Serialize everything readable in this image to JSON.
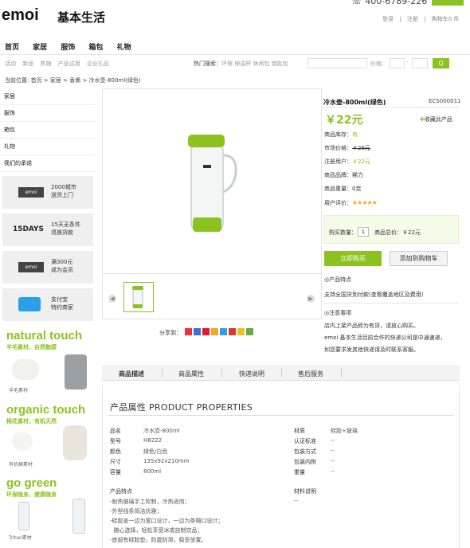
{
  "header": {
    "logo": "emoi",
    "logo_cn": "基本生活",
    "phone": "400-6789-226",
    "links": [
      "登录",
      "|",
      "注册",
      "|",
      "购物车0 件"
    ]
  },
  "nav": [
    "首页",
    "家居",
    "服饰",
    "箱包",
    "礼物"
  ],
  "subnav": [
    "活动",
    "新品",
    "热销",
    "产品试用",
    "企业礼品"
  ],
  "search": {
    "hot_label": "热门搜索：",
    "hot_terms": "环保 保温杯 休闲包 钥匙包",
    "price_label": "价格：",
    "dash": "-",
    "button": "Q"
  },
  "breadcrumb": "当前位置: 首页 > 家居 > 香熏 > 冷水壶-800ml(绿色)",
  "sidebar": {
    "items": [
      "家居",
      "服饰",
      "箱包",
      "礼物",
      "我们的承诺"
    ]
  },
  "promises": [
    {
      "title": "2000城市\n送货上门",
      "icon": "emoi"
    },
    {
      "title": "15天无条件\n退换货款",
      "icon": "15DAYS"
    },
    {
      "title": "满300元\n成为会员",
      "icon": "emoi"
    },
    {
      "title": "支付宝\n特约商家",
      "icon": "puzzle"
    }
  ],
  "promos": [
    {
      "heading": "natural touch",
      "sub": "羊毛素材，自然触感",
      "caption": "羊毛素材"
    },
    {
      "heading": "organic touch",
      "sub": "棉花素材，有机天然",
      "caption": "有机棉素材"
    },
    {
      "heading": "go green",
      "sub": "环保随身，健康随身",
      "caption": "Tritan素材"
    }
  ],
  "product": {
    "title": "冷水壶-800ml(绿色)",
    "code": "ECS000011",
    "price": "￥22元",
    "favorite": "收藏此产品",
    "info": [
      {
        "label": "商品库存：",
        "value": "有",
        "cls": "g"
      },
      {
        "label": "市场价格：",
        "value": "￥26元",
        "cls": "strike"
      },
      {
        "label": "注册用户：",
        "value": "￥22元",
        "cls": "g"
      },
      {
        "label": "商品品牌：",
        "value": "稀力",
        "cls": ""
      },
      {
        "label": "商品重量：",
        "value": "0克",
        "cls": ""
      },
      {
        "label": "用户评价：",
        "value": "★★★★★",
        "cls": "stars"
      }
    ],
    "qty_label": "购买数量：",
    "qty": "1",
    "total_label": "商品总价：",
    "total": "￥22元",
    "buy_now": "立即购买",
    "add_cart": "添加到购物车",
    "feature_title": "◎产品特点",
    "feature_text": "支持全国货到付款(查看覆盖地区及费用)",
    "notice_title": "◎注意事项",
    "notice_lines": [
      "店内上架产品即为有货，请放心购买。",
      "emoi 基本生活目前合作的快递公司是中通速递，",
      "如您要求发其他快递请及时联系客服。"
    ],
    "share": "分享到："
  },
  "tabs": [
    "商品描述",
    "商品属性",
    "快递说明",
    "售后服务"
  ],
  "properties": {
    "title": "产品属性  PRODUCT PROPERTIES",
    "left": [
      {
        "k": "品名",
        "v": "冷水壶-800ml"
      },
      {
        "k": "型号",
        "v": "H8222"
      },
      {
        "k": "颜色",
        "v": "绿色/白色"
      },
      {
        "k": "尺寸",
        "v": "135x92x210mm"
      },
      {
        "k": "容量",
        "v": "800ml"
      }
    ],
    "right": [
      {
        "k": "材质",
        "v": "硅胶+玻璃"
      },
      {
        "k": "认证标准",
        "v": "--"
      },
      {
        "k": "包装方式",
        "v": "--"
      },
      {
        "k": "包装内附",
        "v": "--"
      },
      {
        "k": "重量",
        "v": "--"
      }
    ],
    "features_title": "产品特点",
    "features": [
      "-耐热玻璃手工吹制，冷热适用；",
      "-外型线条简洁优雅；",
      "-硅胶盖一边为宽口设计，一边为茶隔口设计；",
      "  随心选择，轻松享受冰或自制饮品；",
      "-底部有硅胶垫，防震防滑，稳妥放置。"
    ],
    "notes_title": "材料说明",
    "notes": "--"
  }
}
